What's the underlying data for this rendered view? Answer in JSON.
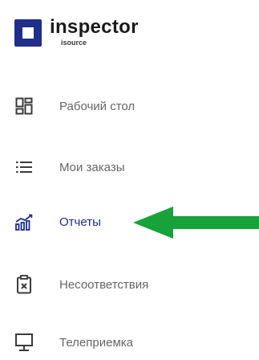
{
  "logo": {
    "title": "inspector",
    "subtitle": "isource"
  },
  "nav": {
    "items": [
      {
        "label": "Рабочий стол",
        "icon": "dashboard-icon"
      },
      {
        "label": "Мои заказы",
        "icon": "list-icon"
      },
      {
        "label": "Отчеты",
        "icon": "bar-chart-icon",
        "active": true
      },
      {
        "label": "Несоответствия",
        "icon": "clipboard-x-icon"
      },
      {
        "label": "Телеприемка",
        "icon": "monitor-icon"
      }
    ]
  },
  "colors": {
    "accent": "#1e2e8a",
    "text": "#666666",
    "arrow": "#18a23a"
  }
}
